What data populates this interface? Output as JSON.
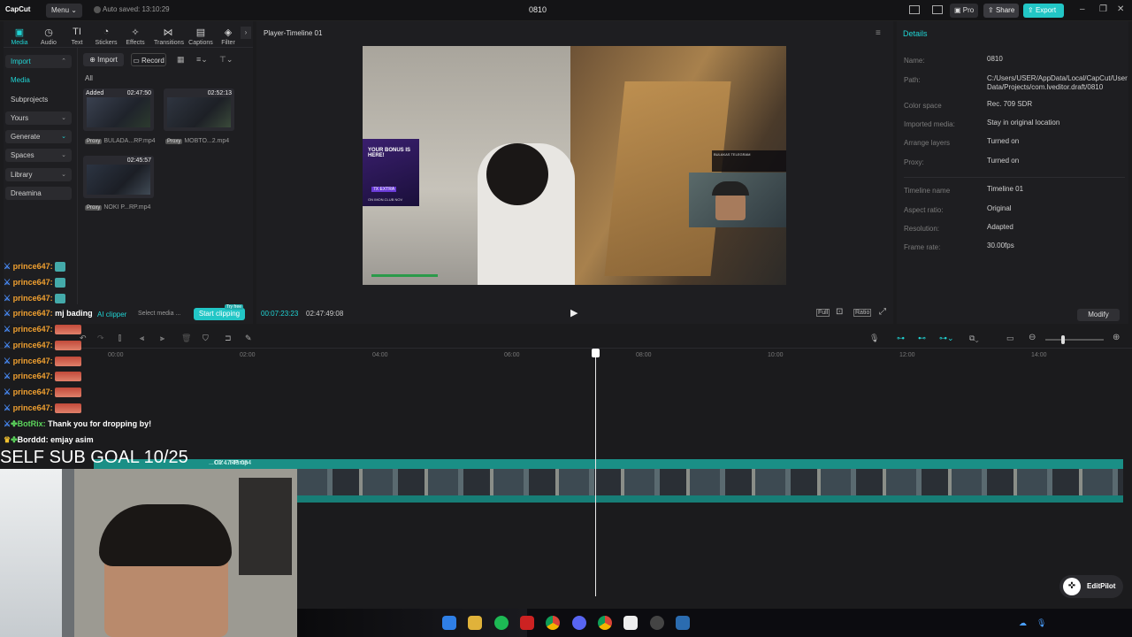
{
  "app": {
    "logo": "CapCut",
    "menu": "Menu",
    "autosave": "Auto saved: 13:10:29",
    "project_title": "0810",
    "pro": "Pro",
    "share": "Share",
    "export": "Export"
  },
  "toolbar": {
    "tabs": [
      "Media",
      "Audio",
      "Text",
      "Stickers",
      "Effects",
      "Transitions",
      "Captions",
      "Filter"
    ]
  },
  "sidebar": {
    "items": [
      {
        "label": "Import"
      },
      {
        "label": "Media"
      },
      {
        "label": "Subprojects"
      },
      {
        "label": "Yours"
      },
      {
        "label": "Generate"
      },
      {
        "label": "Spaces"
      },
      {
        "label": "Library"
      },
      {
        "label": "Dreamina"
      }
    ]
  },
  "media": {
    "import_btn": "Import",
    "record_btn": "Record",
    "filter_all": "All",
    "clips": [
      {
        "tag": "Added",
        "duration": "02:47:50",
        "proxy": "Proxy",
        "name": "BULADA...RP.mp4"
      },
      {
        "tag": "",
        "duration": "02:52:13",
        "proxy": "Proxy",
        "name": "MOBTO...2.mp4"
      },
      {
        "tag": "",
        "duration": "02:45:57",
        "proxy": "Proxy",
        "name": "NOKI P...RP.mp4"
      }
    ],
    "ai_clipper": "AI clipper",
    "select_media": "Select media ...",
    "start_clipping": "Start clipping",
    "try_free": "Try free"
  },
  "player": {
    "title": "Player-Timeline 01",
    "current_time": "00:07:23:23",
    "total_time": "02:47:49:08",
    "full": "Full",
    "ratio": "Ratio",
    "overlay": {
      "ad_title": "YOUR BONUS IS HERE!",
      "ad_sub": "ON IMON.CLUB NOV",
      "ad_badge": "7X EXTRA",
      "chat_line": "BULAKAS TELEGRAM"
    }
  },
  "details": {
    "header": "Details",
    "rows": [
      {
        "label": "Name:",
        "value": "0810"
      },
      {
        "label": "Path:",
        "value": "C:/Users/USER/AppData/Local/CapCut/User Data/Projects/com.lveditor.draft/0810"
      },
      {
        "label": "Color space",
        "value": "Rec. 709 SDR"
      },
      {
        "label": "Imported media:",
        "value": "Stay in original location"
      },
      {
        "label": "Arrange layers",
        "value": "Turned on"
      },
      {
        "label": "Proxy:",
        "value": "Turned on"
      },
      {
        "label": "Timeline name",
        "value": "Timeline 01"
      },
      {
        "label": "Aspect ratio:",
        "value": "Original"
      },
      {
        "label": "Resolution:",
        "value": "Adapted"
      },
      {
        "label": "Frame rate:",
        "value": "30.00fps"
      }
    ],
    "modify": "Modify"
  },
  "timeline": {
    "ticks": [
      "00:00",
      "02:00",
      "04:00",
      "06:00",
      "08:00",
      "10:00",
      "12:00",
      "14:00"
    ],
    "clip_label": "...OV ...RP.mp4",
    "clip_duration": "02:47:49:08",
    "editpilot": "EditPilot"
  },
  "chat": [
    {
      "user": "prince647:",
      "msg": ""
    },
    {
      "user": "prince647:",
      "msg": ""
    },
    {
      "user": "prince647:",
      "msg": ""
    },
    {
      "user": "prince647:",
      "msg": "mj bading"
    },
    {
      "user": "prince647:",
      "msg": ""
    },
    {
      "user": "prince647:",
      "msg": ""
    },
    {
      "user": "prince647:",
      "msg": ""
    },
    {
      "user": "prince647:",
      "msg": ""
    },
    {
      "user": "prince647:",
      "msg": ""
    },
    {
      "user": "prince647:",
      "msg": ""
    },
    {
      "user": "BotRix:",
      "msg": "Thank you for dropping by!"
    },
    {
      "user": "Borddd:",
      "msg": "emjay asim"
    }
  ],
  "stream_goal": "SELF SUB GOAL 10/25",
  "colors": {
    "accent": "#20d4d4",
    "chat_user": "#f0a030",
    "timeline_clip": "#1a8f86"
  }
}
